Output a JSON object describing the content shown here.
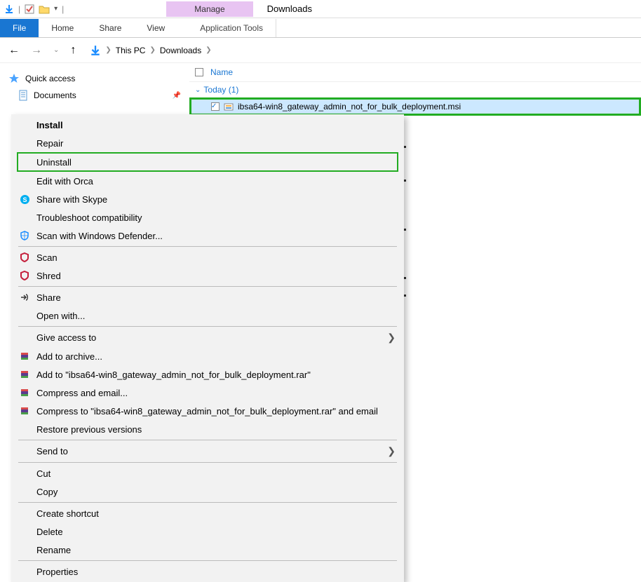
{
  "title": "Downloads",
  "manage_tab": "Manage",
  "apptools_tab": "Application Tools",
  "ribbon": {
    "file": "File",
    "home": "Home",
    "share": "Share",
    "view": "View"
  },
  "breadcrumb": {
    "thispc": "This PC",
    "downloads": "Downloads"
  },
  "sidebar": {
    "quick": "Quick access",
    "documents": "Documents"
  },
  "column": {
    "name": "Name"
  },
  "group": {
    "today": "Today (1)"
  },
  "file": {
    "name": "ibsa64-win8_gateway_admin_not_for_bulk_deployment.msi"
  },
  "menu": {
    "install": "Install",
    "repair": "Repair",
    "uninstall": "Uninstall",
    "edit_orca": "Edit with Orca",
    "skype": "Share with Skype",
    "troubleshoot": "Troubleshoot compatibility",
    "defender": "Scan with Windows Defender...",
    "scan": "Scan",
    "shred": "Shred",
    "share": "Share",
    "openwith": "Open with...",
    "giveaccess": "Give access to",
    "addarchive": "Add to archive...",
    "addrar": "Add to \"ibsa64-win8_gateway_admin_not_for_bulk_deployment.rar\"",
    "compress_email": "Compress and email...",
    "compress_rar_email": "Compress to \"ibsa64-win8_gateway_admin_not_for_bulk_deployment.rar\" and email",
    "restore": "Restore previous versions",
    "sendto": "Send to",
    "cut": "Cut",
    "copy": "Copy",
    "shortcut": "Create shortcut",
    "delete": "Delete",
    "rename": "Rename",
    "properties": "Properties"
  }
}
